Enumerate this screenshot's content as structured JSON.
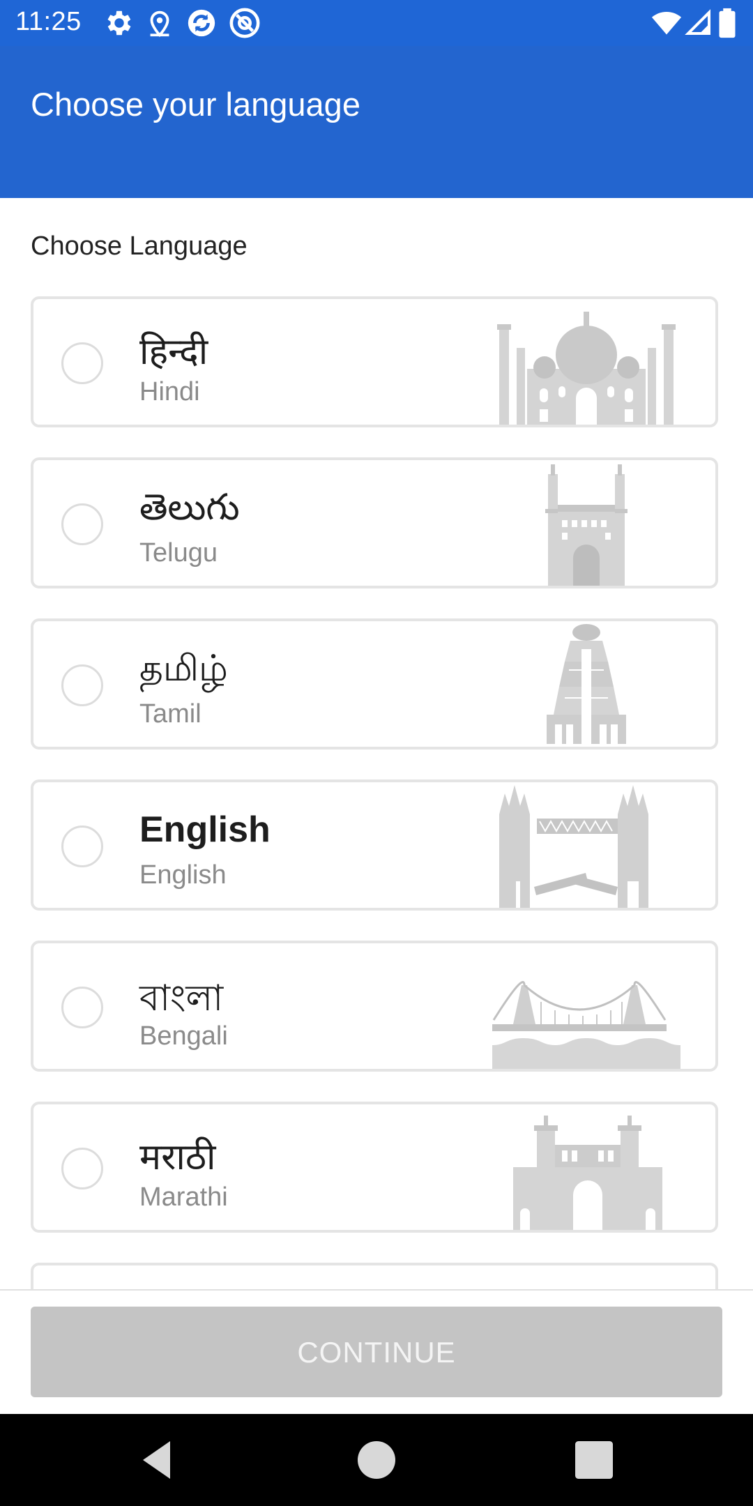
{
  "status_bar": {
    "time": "11:25",
    "left_icons": [
      "gear-icon",
      "location-icon",
      "sync-icon",
      "at-sign-icon"
    ],
    "right_icons": [
      "wifi-icon",
      "signal-icon",
      "battery-icon"
    ]
  },
  "app_bar": {
    "title": "Choose your language"
  },
  "section": {
    "label": "Choose Language"
  },
  "languages": [
    {
      "native": "हिन्दी",
      "english": "Hindi",
      "landmark": "taj-mahal-icon"
    },
    {
      "native": "తెలుగు",
      "english": "Telugu",
      "landmark": "charminar-icon"
    },
    {
      "native": "தமிழ்",
      "english": "Tamil",
      "landmark": "temple-gopuram-icon"
    },
    {
      "native": "English",
      "english": "English",
      "landmark": "tower-bridge-icon"
    },
    {
      "native": "বাংলা",
      "english": "Bengali",
      "landmark": "howrah-bridge-icon"
    },
    {
      "native": "मराठी",
      "english": "Marathi",
      "landmark": "gateway-of-india-icon"
    }
  ],
  "footer": {
    "continue_label": "CONTINUE"
  },
  "nav_bar": {
    "icons": [
      "back-icon",
      "home-icon",
      "recents-icon"
    ]
  },
  "colors": {
    "app_bar": "#2365cf",
    "button_disabled": "#c4c4c4",
    "card_border": "#e4e4e4"
  }
}
